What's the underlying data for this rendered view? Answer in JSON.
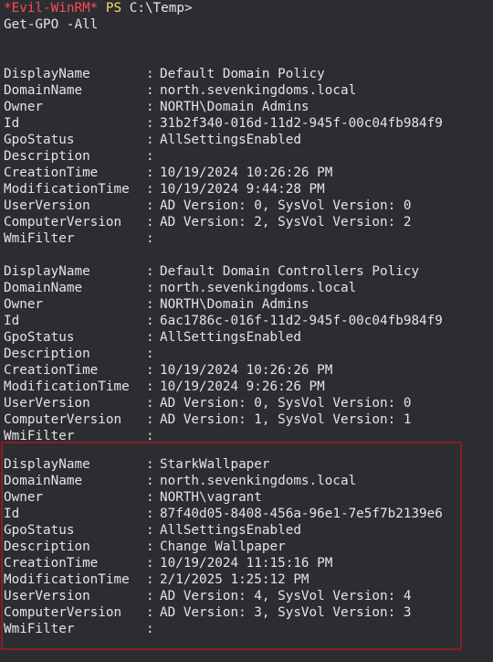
{
  "prompt": {
    "host": "*Evil-WinRM*",
    "ps": "PS",
    "path": "C:\\Temp>"
  },
  "command": "Get-GPO -All",
  "separator": ":",
  "colors": {
    "background": "#2b2d33",
    "text": "#e4e4e4",
    "prompt_host": "#ff4d4d",
    "prompt_ps": "#ffd95c",
    "highlight_border": "#8a1d24"
  },
  "gpos": [
    {
      "fields": [
        {
          "key": "DisplayName",
          "value": "Default Domain Policy"
        },
        {
          "key": "DomainName",
          "value": "north.sevenkingdoms.local"
        },
        {
          "key": "Owner",
          "value": "NORTH\\Domain Admins"
        },
        {
          "key": "Id",
          "value": "31b2f340-016d-11d2-945f-00c04fb984f9"
        },
        {
          "key": "GpoStatus",
          "value": "AllSettingsEnabled"
        },
        {
          "key": "Description",
          "value": ""
        },
        {
          "key": "CreationTime",
          "value": "10/19/2024 10:26:26 PM"
        },
        {
          "key": "ModificationTime",
          "value": "10/19/2024 9:44:28 PM"
        },
        {
          "key": "UserVersion",
          "value": "AD Version: 0, SysVol Version: 0"
        },
        {
          "key": "ComputerVersion",
          "value": "AD Version: 2, SysVol Version: 2"
        },
        {
          "key": "WmiFilter",
          "value": ""
        }
      ]
    },
    {
      "fields": [
        {
          "key": "DisplayName",
          "value": "Default Domain Controllers Policy"
        },
        {
          "key": "DomainName",
          "value": "north.sevenkingdoms.local"
        },
        {
          "key": "Owner",
          "value": "NORTH\\Domain Admins"
        },
        {
          "key": "Id",
          "value": "6ac1786c-016f-11d2-945f-00c04fb984f9"
        },
        {
          "key": "GpoStatus",
          "value": "AllSettingsEnabled"
        },
        {
          "key": "Description",
          "value": ""
        },
        {
          "key": "CreationTime",
          "value": "10/19/2024 10:26:26 PM"
        },
        {
          "key": "ModificationTime",
          "value": "10/19/2024 9:26:26 PM"
        },
        {
          "key": "UserVersion",
          "value": "AD Version: 0, SysVol Version: 0"
        },
        {
          "key": "ComputerVersion",
          "value": "AD Version: 1, SysVol Version: 1"
        },
        {
          "key": "WmiFilter",
          "value": ""
        }
      ]
    },
    {
      "fields": [
        {
          "key": "DisplayName",
          "value": "StarkWallpaper"
        },
        {
          "key": "DomainName",
          "value": "north.sevenkingdoms.local"
        },
        {
          "key": "Owner",
          "value": "NORTH\\vagrant"
        },
        {
          "key": "Id",
          "value": "87f40d05-8408-456a-96e1-7e5f7b2139e6"
        },
        {
          "key": "GpoStatus",
          "value": "AllSettingsEnabled"
        },
        {
          "key": "Description",
          "value": "Change Wallpaper"
        },
        {
          "key": "CreationTime",
          "value": "10/19/2024 11:15:16 PM"
        },
        {
          "key": "ModificationTime",
          "value": "2/1/2025 1:25:12 PM"
        },
        {
          "key": "UserVersion",
          "value": "AD Version: 4, SysVol Version: 4"
        },
        {
          "key": "ComputerVersion",
          "value": "AD Version: 3, SysVol Version: 3"
        },
        {
          "key": "WmiFilter",
          "value": ""
        }
      ]
    }
  ]
}
